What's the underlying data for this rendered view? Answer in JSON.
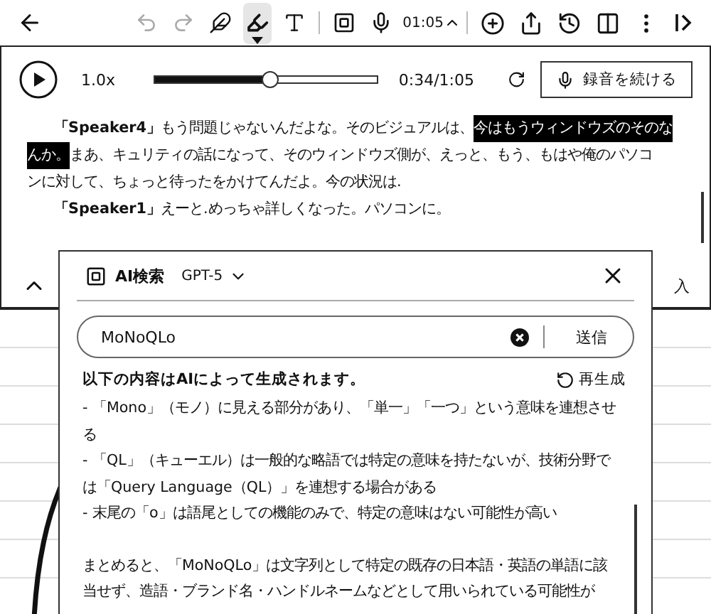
{
  "toolbar": {
    "history": [
      {
        "kind": "undo",
        "disabled": true
      },
      {
        "kind": "redo",
        "disabled": true
      }
    ],
    "tools": [
      {
        "kind": "pen",
        "selected": false
      },
      {
        "kind": "marker",
        "selected": true
      },
      {
        "kind": "text",
        "selected": false
      }
    ],
    "recording_time": "01:05",
    "actions": [
      {
        "kind": "add"
      },
      {
        "kind": "share"
      },
      {
        "kind": "history"
      },
      {
        "kind": "split"
      },
      {
        "kind": "more"
      },
      {
        "kind": "collapse"
      }
    ]
  },
  "player": {
    "speed": "1.0x",
    "level": 0.52,
    "time": "0:34/1:05",
    "continue_button": "録音を続ける"
  },
  "transcript": {
    "lines": [
      {
        "indented": true,
        "segments": [
          {
            "kind": "speaker",
            "text": "「Speaker4」",
            "highlighted": false
          },
          {
            "kind": "text",
            "text": "もう問題じゃないんだよな。そのビジュアルは、",
            "highlighted": false
          },
          {
            "kind": "text",
            "text": "今はもうウィンドウズのそのな",
            "highlighted": true
          }
        ]
      },
      {
        "indented": false,
        "segments": [
          {
            "kind": "text",
            "text": "んか。",
            "highlighted": true
          },
          {
            "kind": "text",
            "text": "まあ、キュリティの話になって、そのウィンドウズ側が、えっと、もう、もはや俺のパソコ",
            "highlighted": false
          }
        ]
      },
      {
        "indented": false,
        "segments": [
          {
            "kind": "text",
            "text": "ンに対して、ちょっと待ったをかけてんだよ。今の状況は.",
            "highlighted": false
          }
        ]
      },
      {
        "indented": true,
        "segments": [
          {
            "kind": "speaker",
            "text": "「Speaker1」",
            "highlighted": false
          },
          {
            "kind": "text",
            "text": "えーと.めっちゃ詳しくなった。パソコンに。",
            "highlighted": false
          }
        ]
      }
    ],
    "insert_label": "入"
  },
  "ai_panel": {
    "title": "AI検索",
    "model": "GPT-5",
    "search": {
      "value": "MoNoQLo",
      "submit": "送信"
    },
    "notice": "以下の内容はAIによって生成されます。",
    "regenerate": "再生成",
    "lines": [
      " - 「Mono」（モノ）に見える部分があり、「単一」「一つ」という意味を連想させる",
      " - 「QL」（キューエル）は一般的な略語では特定の意味を持たないが、技術分野では「Query Language（QL）」を連想する場合がある",
      "- 末尾の「o」は語尾としての機能のみで、特定の意味はない可能性が高い",
      "まとめると、「MoNoQLo」は文字列として特定の既存の日本語・英語の単語に該当せず、造語・ブランド名・ハンドルネームなどとして用いられている可能性が"
    ]
  }
}
